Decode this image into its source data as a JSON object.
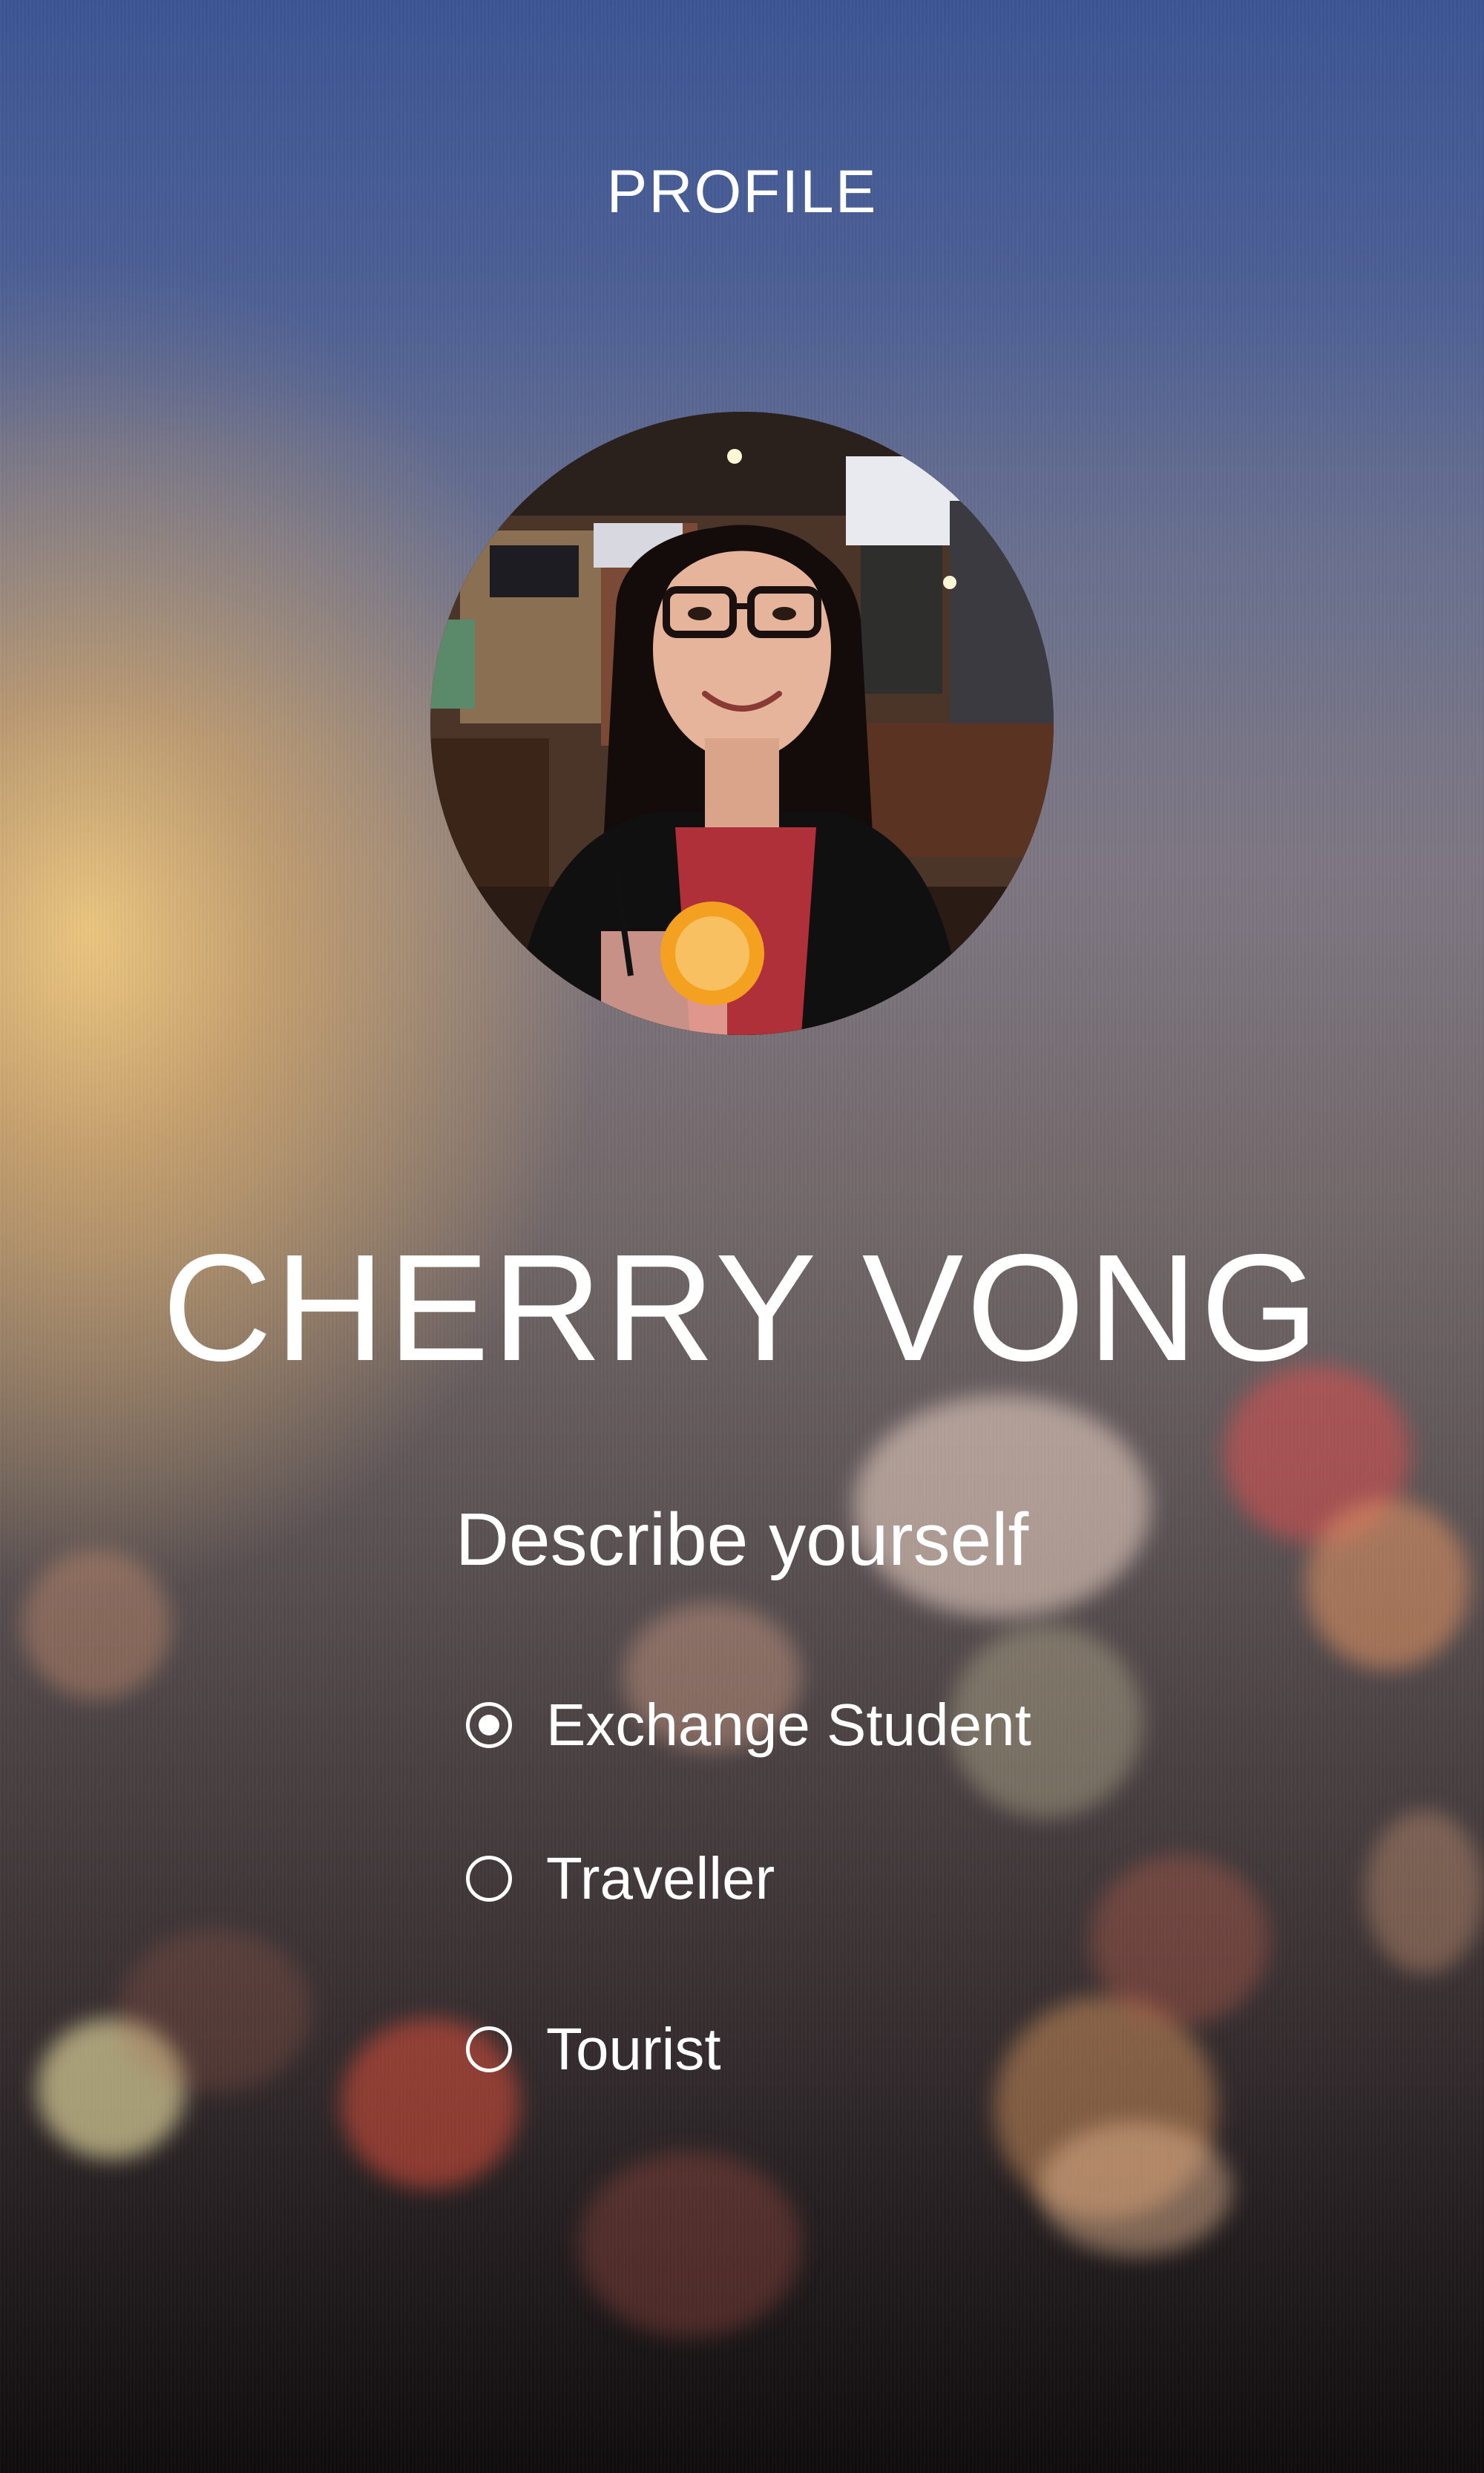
{
  "header": {
    "title": "PROFILE"
  },
  "profile": {
    "avatar_description": "profile-photo",
    "name": "CHERRY VONG"
  },
  "question": {
    "label": "Describe yourself",
    "options": [
      {
        "label": "Exchange Student",
        "selected": true
      },
      {
        "label": "Traveller",
        "selected": false
      },
      {
        "label": "Tourist",
        "selected": false
      }
    ]
  },
  "colors": {
    "text": "#ffffff",
    "top": "#3e5a95",
    "warm": "#eec880",
    "bottom": "#0f0c0d"
  }
}
